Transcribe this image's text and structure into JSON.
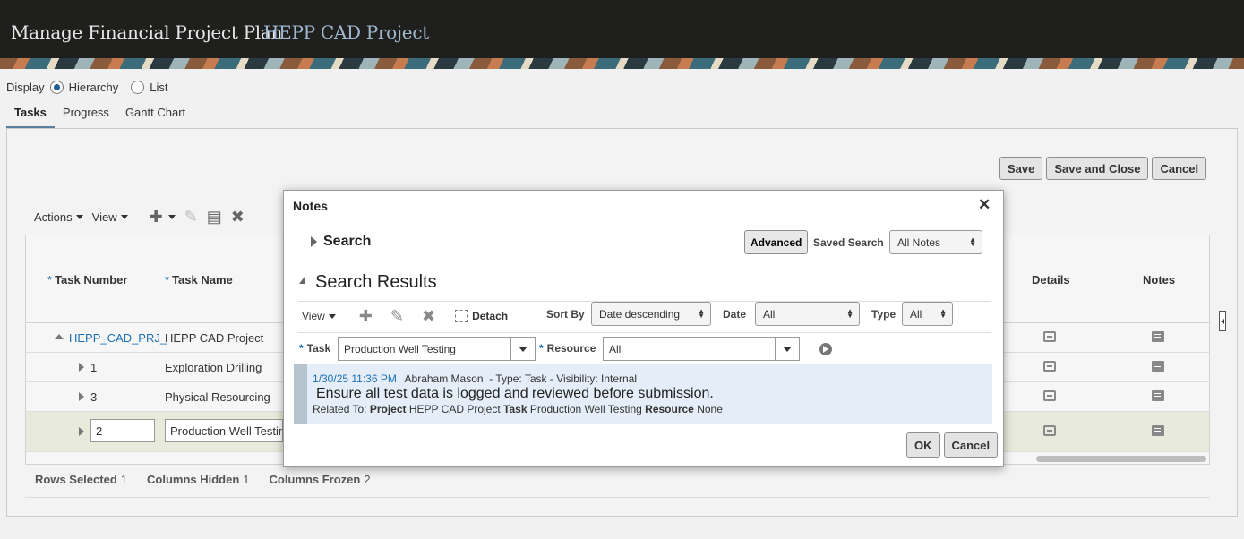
{
  "header": {
    "title": "Manage Financial Project Plan",
    "project": "HEPP CAD Project"
  },
  "display": {
    "label": "Display",
    "options": [
      "Hierarchy",
      "List"
    ],
    "selected": "Hierarchy"
  },
  "tabs": [
    {
      "label": "Tasks",
      "active": true
    },
    {
      "label": "Progress"
    },
    {
      "label": "Gantt Chart"
    }
  ],
  "page_actions": {
    "save": "Save",
    "save_close": "Save and Close",
    "cancel": "Cancel"
  },
  "toolbar": {
    "actions": "Actions",
    "view": "View"
  },
  "table": {
    "columns": {
      "task_number": "Task Number",
      "task_name": "Task Name",
      "details": "Details",
      "notes": "Notes"
    },
    "rows": [
      {
        "number": "HEPP_CAD_PRJ_",
        "name": "HEPP CAD Project"
      },
      {
        "number": "1",
        "name": "Exploration Drilling"
      },
      {
        "number": "3",
        "name": "Physical Resourcing"
      },
      {
        "number": "2",
        "name": "Production Well Testing"
      }
    ]
  },
  "status_bar": {
    "rows_selected_label": "Rows Selected",
    "rows_selected": "1",
    "columns_hidden_label": "Columns Hidden",
    "columns_hidden": "1",
    "columns_frozen_label": "Columns Frozen",
    "columns_frozen": "2"
  },
  "dialog": {
    "title": "Notes",
    "search_label": "Search",
    "advanced": "Advanced",
    "saved_search_label": "Saved Search",
    "saved_search_value": "All Notes",
    "results_label": "Search Results",
    "view": "View",
    "detach": "Detach",
    "sort_by_label": "Sort By",
    "sort_by_value": "Date descending",
    "date_label": "Date",
    "date_value": "All",
    "type_label": "Type",
    "type_value": "All",
    "task_label": "Task",
    "task_value": "Production Well Testing",
    "resource_label": "Resource",
    "resource_value": "All",
    "note": {
      "datetime": "1/30/25 11:36 PM",
      "author": "Abraham Mason",
      "type_text": "- Type:",
      "type": "Task",
      "visibility_text": "- Visibility:",
      "visibility": "Internal",
      "body": "Ensure all test data is logged and reviewed before submission.",
      "related_to": "Related To:",
      "project_label": "Project",
      "project": "HEPP CAD Project",
      "task_label": "Task",
      "task": "Production Well Testing",
      "resource_label": "Resource",
      "resource": "None"
    },
    "ok": "OK",
    "cancel": "Cancel"
  }
}
